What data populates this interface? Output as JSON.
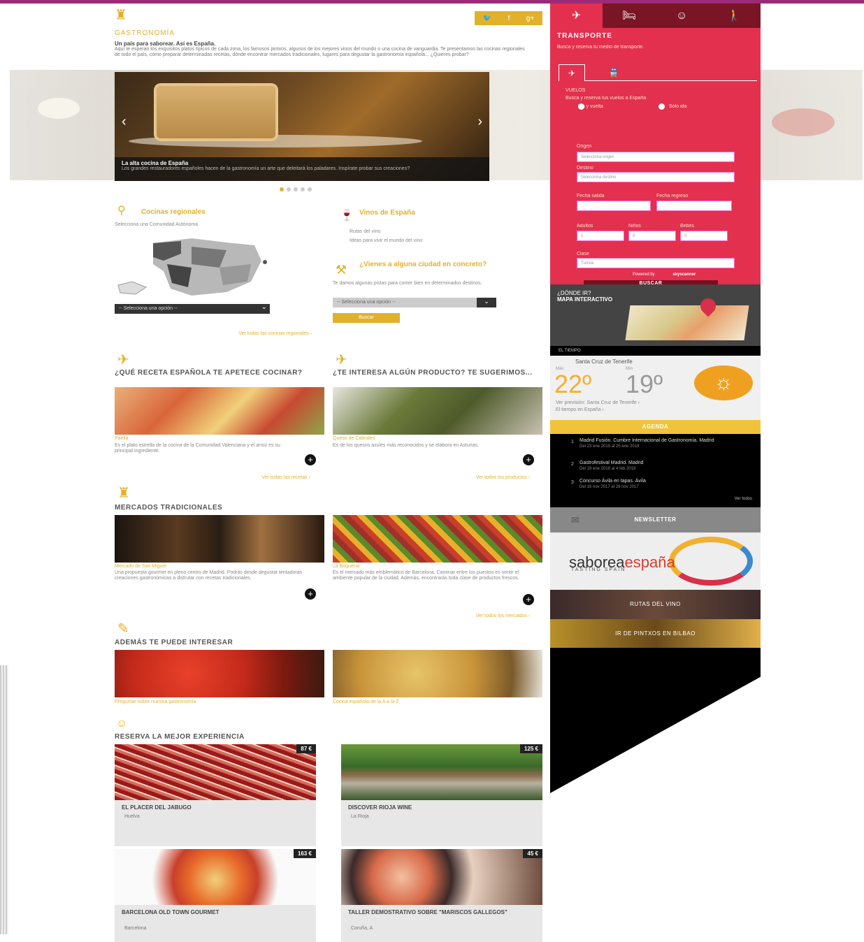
{
  "social": {
    "twitter": "🐦",
    "facebook": "f",
    "plus": "g+"
  },
  "gastro": {
    "title": "GASTRONOMÍA",
    "headline": "Un país para saborear. Así es España.",
    "intro": "Aquí te esperan los exquisitos platos típicos de cada zona, los famosos pintxos, algunos de los mejores vinos del mundo o una cocina de vanguardia. Te presentamos las cocinas regionales de todo el país, cómo preparar determinadas recetas, dónde encontrar mercados tradicionales, lugares para degustar la gastronomía española... ¿Quieres probar?"
  },
  "slider": {
    "caption_title": "La alta cocina de España",
    "caption_text": "Los grandes restauradores españoles hacen de la gastronomía un arte que deleitará los paladares. Inspírate probar sus creaciones?",
    "prev": "‹",
    "next": "›"
  },
  "regional": {
    "title": "Cocinas regionales",
    "subtitle": "Selecciona una Comunidad Autónoma",
    "select": "-- Selecciona una opción --",
    "link": "Ver todas las cocinas regionales ›"
  },
  "wines": {
    "title": "Vinos de España",
    "items": [
      "Rutas del vino",
      "Ideas para vivir el mundo del vino"
    ]
  },
  "travel": {
    "title": "¿Vienes a alguna ciudad en concreto?",
    "text": "Te damos algunas pistas para comer bien en determinados destinos.",
    "select": "-- Selecciona una opción --",
    "button": "Buscar"
  },
  "recipe": {
    "title": "¿QUÉ RECETA ESPAÑOLA TE APETECE COCINAR?",
    "name": "Paella",
    "text": "Es el plato estrella de la cocina de la Comunidad Valenciana y el arroz es su principal ingrediente.",
    "link": "Ver todas las recetas ›"
  },
  "product": {
    "title": "¿TE INTERESA ALGÚN PRODUCTO? TE SUGERIMOS...",
    "name": "Queso de Cabrales",
    "text": "Es de los quesos azules más reconocidos y se elabora en Asturias.",
    "link": "Ver todos los productos ›"
  },
  "markets": {
    "title": "MERCADOS TRADICIONALES",
    "m1_name": "Mercado de San Miguel",
    "m1_text": "Una propuesta gourmet en pleno centro de Madrid. Podrás desde degustar tentadoras creaciones gastronómicas a disfrutar con recetas tradicionales.",
    "m2_name": "La Boquería",
    "m2_text": "Es el mercado más emblemático de Barcelona. Caminar entre los puestos es sentir el ambiente popular de la ciudad. Además, encontrarás toda clase de productos frescos.",
    "link": "Ver todos los mercados ›"
  },
  "also": {
    "title": "ADEMÁS TE PUEDE INTERESAR",
    "c1": "Preguntar sobre nuestra gastronomía",
    "c2": "Cocina española de la A a la Z"
  },
  "experiences": {
    "title": "RESERVA LA MEJOR EXPERIENCIA",
    "items": [
      {
        "price": "87 €",
        "title": "EL PLACER DEL JABUGO",
        "loc": "Huelva"
      },
      {
        "price": "125 €",
        "title": "DISCOVER RIOJA WINE",
        "loc": "La Rioja"
      },
      {
        "price": "163 €",
        "title": "BARCELONA OLD TOWN GOURMET",
        "loc": "Barcelona"
      },
      {
        "price": "45 €",
        "title": "TALLER DEMOSTRATIVO SOBRE \"MARISCOS GALLEGOS\"",
        "loc": "Coruña, A"
      }
    ]
  },
  "transport": {
    "tabs": [
      "✈",
      "🛏",
      "☺",
      "🚶"
    ],
    "title": "TRANSPORTE",
    "subtitle": "Busca y reserva tu medio de transporte.",
    "sub_tabs": [
      "✈",
      "🚆"
    ],
    "section": "VUELOS",
    "section_sub": "Busca y reserva tus vuelos a España",
    "radio1": "Ida y vuelta",
    "radio2": "Sólo ida",
    "origin_lbl": "Origen",
    "origin": "Selecciona origen",
    "dest_lbl": "Destino",
    "dest": "Selecciona destino",
    "date1_lbl": "Fecha salida",
    "date2_lbl": "Fecha regreso",
    "adults_lbl": "Adultos",
    "adults": "1",
    "kids_lbl": "Niños",
    "kids": "0",
    "babies_lbl": "Bebés",
    "babies": "0",
    "class_lbl": "Clase",
    "class": "Turista",
    "button": "BUSCAR",
    "powered": "Powered by",
    "partner": "skyscanner"
  },
  "mapa": {
    "l1": "¿DÓNDE IR?",
    "l2": "MAPA INTERACTIVO"
  },
  "weather": {
    "label": "EL TIEMPO",
    "city": "Santa Cruz de Tenerife",
    "max_lbl": "Máx",
    "min_lbl": "Mín",
    "max": "22º",
    "min": "19º",
    "link1": "Ver previsión: Santa Cruz de Tenerife ›",
    "link2": "El tiempo en España ›"
  },
  "agenda": {
    "title": "AGENDA",
    "items": [
      {
        "n": "1",
        "t": "Madrid Fusión. Cumbre Internacional de Gastronomía. Madrid",
        "d": "Del 23 ene 2018 al 25 ene 2018"
      },
      {
        "n": "2",
        "t": "Gastrofestival Madrid. Madrid",
        "d": "Del 19 ene 2018 al 4 feb 2018"
      },
      {
        "n": "3",
        "t": "Concurso Ávila en tapas. Ávila",
        "d": "Del 16 nov 2017 al 26 nov 2017"
      }
    ],
    "all": "Ver todos"
  },
  "newsletter": "NEWSLETTER",
  "brand": {
    "a": "saborea",
    "b": "españa",
    "sub": "TASTING SPAIN"
  },
  "promo1": "RUTAS DEL VINO",
  "promo2": "IR DE PINTXOS EN BILBAO"
}
